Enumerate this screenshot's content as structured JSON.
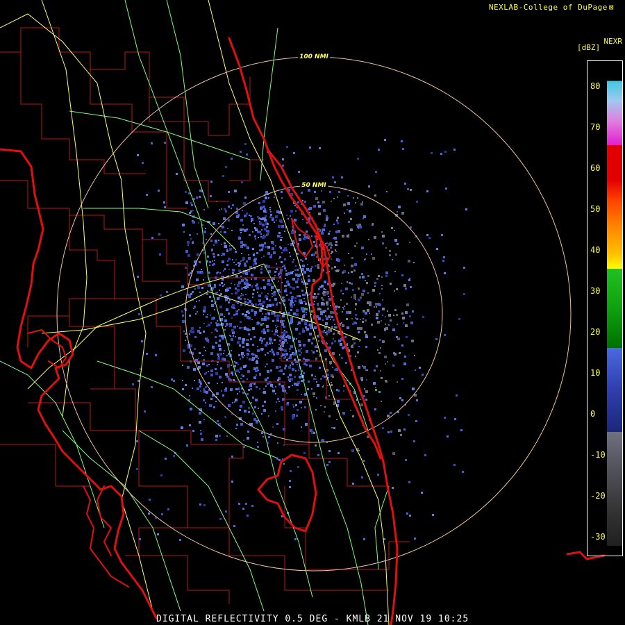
{
  "header": {
    "credit": "NEXLAB-College of DuPage",
    "product": "NEXR",
    "units": "[dBZ]"
  },
  "footer": {
    "caption": "DIGITAL REFLECTIVITY 0.5 DEG - KMLB 21 NOV 19 10:25"
  },
  "range_rings": [
    {
      "label": "100 NMI"
    },
    {
      "label": "50 NMI"
    }
  ],
  "scale": {
    "ticks": [
      "80",
      "70",
      "60",
      "50",
      "40",
      "30",
      "20",
      "10",
      "0",
      "-10",
      "-20",
      "-30"
    ],
    "colors": {
      "cyan": "#3ec8e0",
      "magenta": "#e020d0",
      "red": "#e00000",
      "orange": "#ff8000",
      "yellow": "#ffff00",
      "green": "#20c020",
      "dark_green": "#007000",
      "blue": "#4a6ae0",
      "navy": "#1a2878",
      "gray": "#707080",
      "dark_gray": "#202020"
    }
  },
  "map_colors": {
    "coastline": "#e01010",
    "county": "#c01818",
    "highway": "#ffff70",
    "road": "#80ff80",
    "ring": "#f0c0a0"
  }
}
